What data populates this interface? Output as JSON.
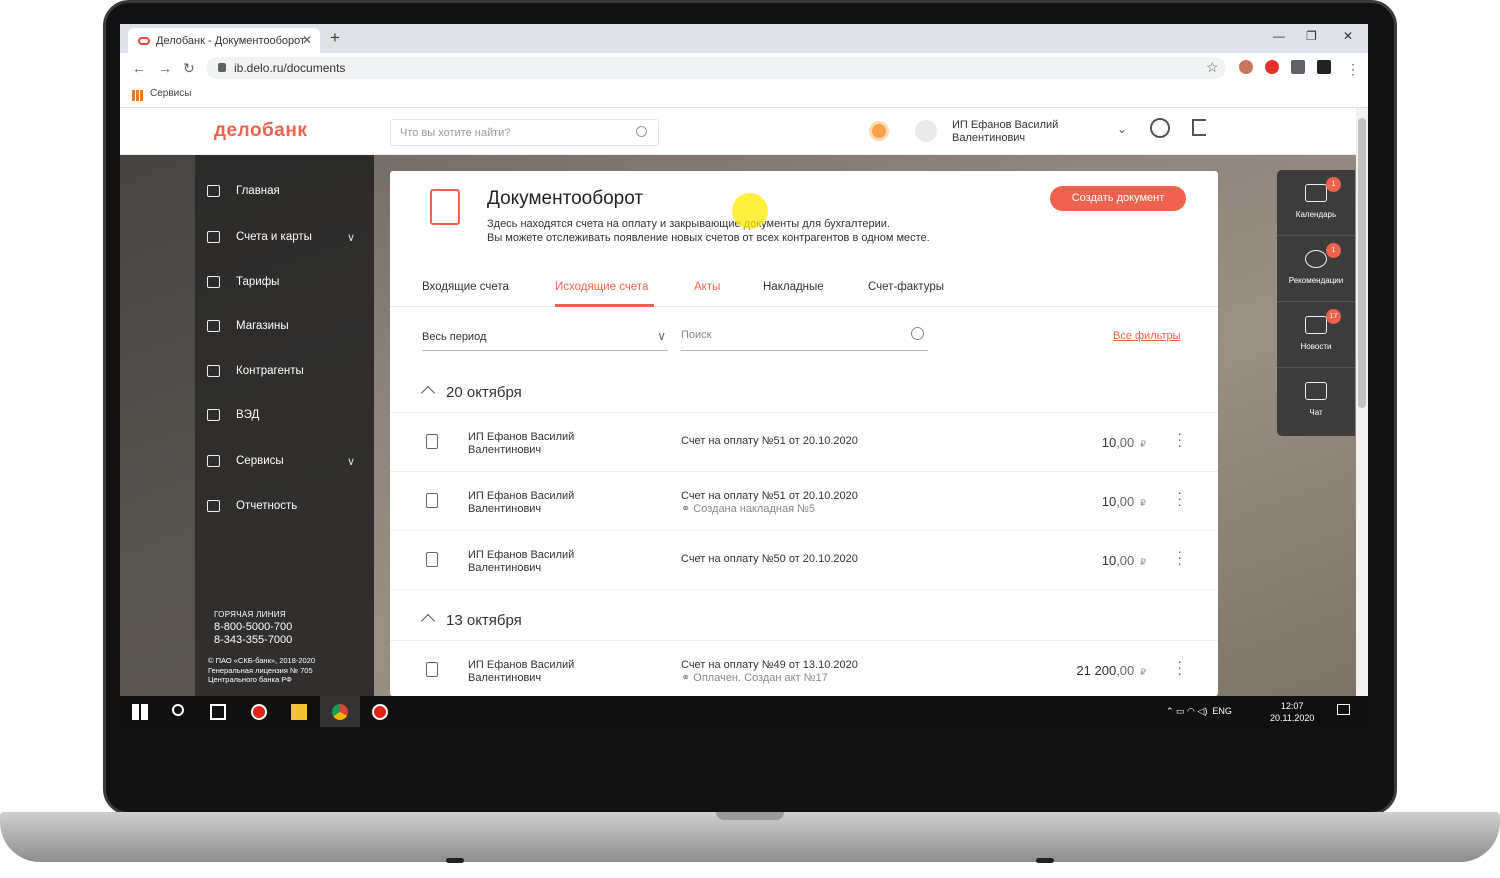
{
  "browser": {
    "tab_title": "Делобанк - Документооборот",
    "url": "ib.delo.ru/documents",
    "bookmarks_label": "Сервисы"
  },
  "header": {
    "logo": "делобанк",
    "search_placeholder": "Что вы хотите найти?",
    "user_name": "ИП Ефанов Василий Валентинович"
  },
  "sidebar": {
    "items": [
      {
        "label": "Главная",
        "icon": "home-icon"
      },
      {
        "label": "Счета и карты",
        "icon": "accounts-icon",
        "expandable": true
      },
      {
        "label": "Тарифы",
        "icon": "tariffs-icon"
      },
      {
        "label": "Магазины",
        "icon": "shop-icon"
      },
      {
        "label": "Контрагенты",
        "icon": "contractors-icon"
      },
      {
        "label": "ВЭД",
        "icon": "globe-icon"
      },
      {
        "label": "Сервисы",
        "icon": "services-icon",
        "expandable": true
      },
      {
        "label": "Отчетность",
        "icon": "reports-icon"
      }
    ],
    "hotline_caption": "ГОРЯЧАЯ ЛИНИЯ",
    "phone1": "8-800-5000-700",
    "phone2": "8-343-355-7000",
    "copyright1": "© ПАО «СКБ-банк», 2018-2020",
    "copyright2": "Генеральная лицензия № 705",
    "copyright3": "Центрального банка РФ"
  },
  "main": {
    "title": "Документооборот",
    "subtitle1": "Здесь находятся счета на оплату и закрывающие документы для бухгалтерии.",
    "subtitle2": "Вы можете отслеживать появление новых счетов от всех контрагентов в одном месте.",
    "create_button": "Создать документ",
    "tabs": [
      "Входящие счета",
      "Исходящие счета",
      "Акты",
      "Накладные",
      "Счет-фактуры"
    ],
    "active_tab": "Исходящие счета",
    "period": "Весь период",
    "search_placeholder": "Поиск",
    "all_filters": "Все фильтры",
    "groups": [
      {
        "date": "20 октября",
        "rows": [
          {
            "name1": "ИП Ефанов Василий",
            "name2": "Валентинович",
            "doc": "Счет на оплату №51 от 20.10.2020",
            "note": "",
            "amount": "10",
            "cents": ",00",
            "currency": "₽"
          },
          {
            "name1": "ИП Ефанов Василий",
            "name2": "Валентинович",
            "doc": "Счет на оплату №51 от 20.10.2020",
            "note": "Создана накладная №5",
            "amount": "10",
            "cents": ",00",
            "currency": "₽"
          },
          {
            "name1": "ИП Ефанов Василий",
            "name2": "Валентинович",
            "doc": "Счет на оплату №50 от 20.10.2020",
            "note": "",
            "amount": "10",
            "cents": ",00",
            "currency": "₽"
          }
        ]
      },
      {
        "date": "13 октября",
        "rows": [
          {
            "name1": "ИП Ефанов Василий",
            "name2": "Валентинович",
            "doc": "Счет на оплату №49 от 13.10.2020",
            "note": "Оплачен. Создан акт №17",
            "amount": "21 200",
            "cents": ",00",
            "currency": "₽"
          }
        ]
      }
    ]
  },
  "right_panel": [
    {
      "label": "Календарь",
      "badge": "1"
    },
    {
      "label": "Рекомендации",
      "badge": "1"
    },
    {
      "label": "Новости",
      "badge": "17"
    },
    {
      "label": "Чат",
      "badge": ""
    }
  ],
  "taskbar": {
    "lang": "ENG",
    "time": "12:07",
    "date": "20.11.2020"
  },
  "colors": {
    "accent": "#f0624d",
    "sidebar": "#2b2b2b"
  }
}
